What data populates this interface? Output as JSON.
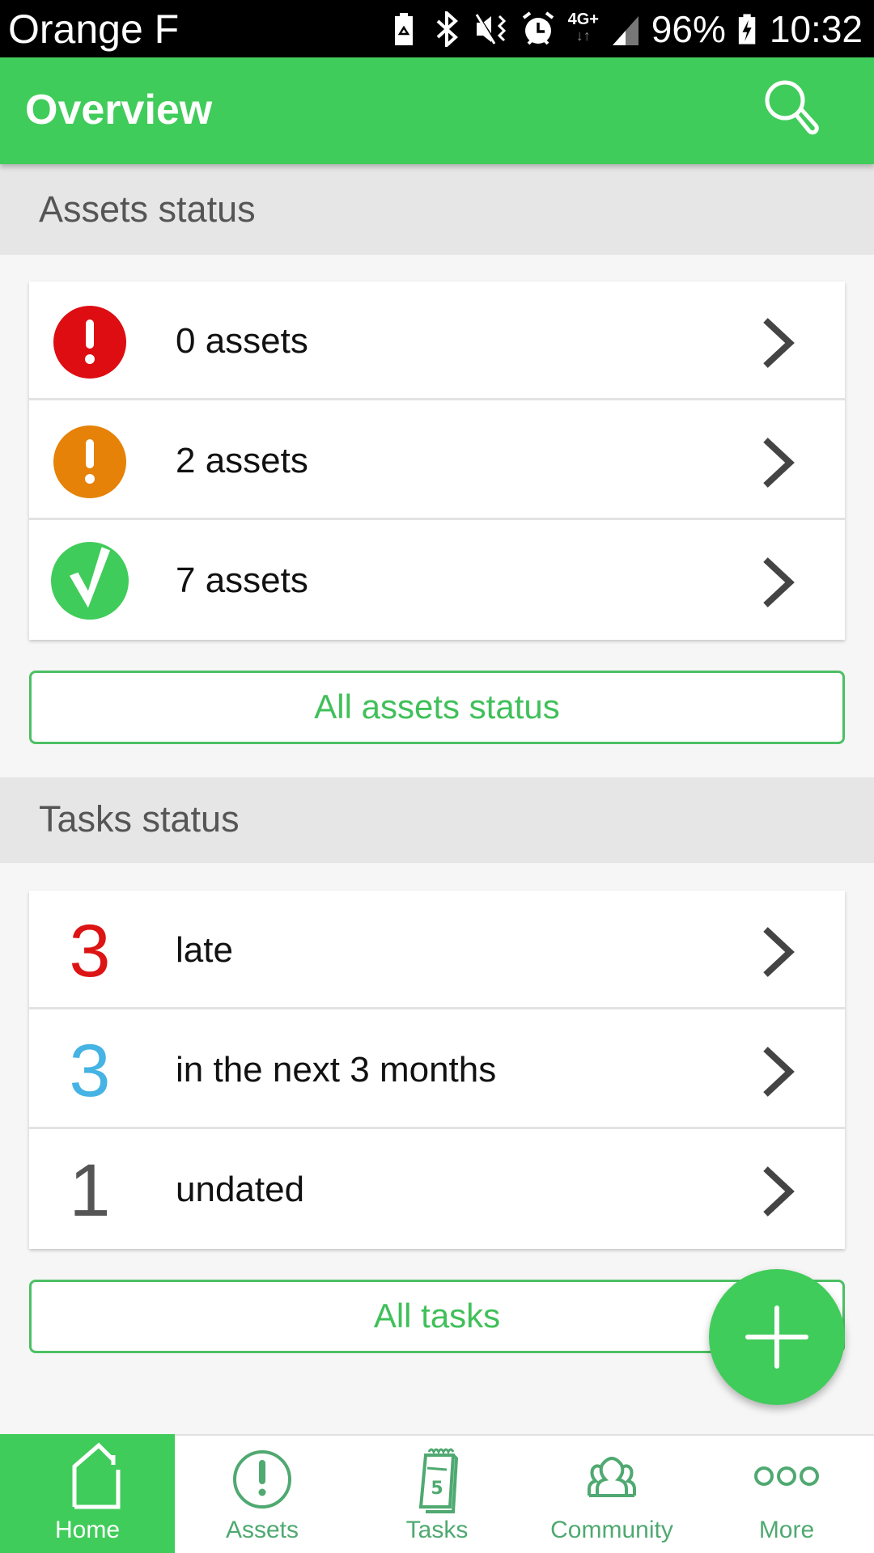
{
  "status_bar": {
    "carrier": "Orange F",
    "network": "4G+",
    "battery": "96%",
    "time": "10:32",
    "icons": [
      "battery-saver-icon",
      "bluetooth-icon",
      "vibrate-icon",
      "alarm-icon",
      "network-4g-icon",
      "signal-icon",
      "battery-charging-icon"
    ]
  },
  "app_bar": {
    "title": "Overview",
    "search_icon": "search-icon"
  },
  "assets_section": {
    "title": "Assets status",
    "rows": [
      {
        "label": "0 assets",
        "icon": "alert-icon",
        "color": "#dd0d12"
      },
      {
        "label": "2 assets",
        "icon": "warning-icon",
        "color": "#e58207"
      },
      {
        "label": "7 assets",
        "icon": "check-icon",
        "color": "#40cc5a"
      }
    ],
    "button_label": "All assets status"
  },
  "tasks_section": {
    "title": "Tasks status",
    "rows": [
      {
        "count": "3",
        "label": "late",
        "color": "#dd1414"
      },
      {
        "count": "3",
        "label": "in the next 3 months",
        "color": "#45b3e3"
      },
      {
        "count": "1",
        "label": "undated",
        "color": "#555555"
      }
    ],
    "button_label": "All tasks"
  },
  "fab": {
    "icon": "plus-icon",
    "label": "Add"
  },
  "bottom_nav": {
    "active": "Home",
    "tabs": [
      {
        "label": "Home",
        "icon": "home-icon"
      },
      {
        "label": "Assets",
        "icon": "assets-alert-icon"
      },
      {
        "label": "Tasks",
        "icon": "calendar-icon",
        "icon_text": "5"
      },
      {
        "label": "Community",
        "icon": "community-icon"
      },
      {
        "label": "More",
        "icon": "more-icon"
      }
    ]
  },
  "colors": {
    "primary": "#40cc5a",
    "nav_icon": "#4fa971",
    "section_header_bg": "#e6e6e6",
    "chevron": "#444444"
  }
}
